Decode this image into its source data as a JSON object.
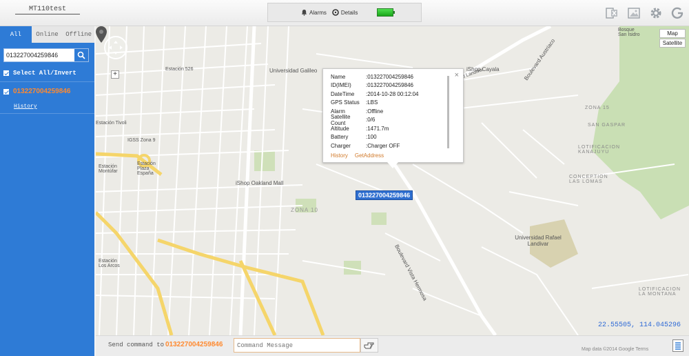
{
  "header": {
    "device_title": "MT110test",
    "alarms_label": "Alarms",
    "details_label": "Details",
    "icons": [
      "excel-icon",
      "image-icon",
      "gear-icon",
      "logout-icon"
    ]
  },
  "sidebar": {
    "tabs": [
      {
        "label": "All",
        "active": true
      },
      {
        "label": "Online",
        "active": false
      },
      {
        "label": "Offline",
        "active": false
      }
    ],
    "search_value": "013227004259846",
    "select_all_label": "Select All/Invert",
    "devices": [
      {
        "imei": "013227004259846",
        "history_label": "History"
      }
    ]
  },
  "map": {
    "map_button": "Map",
    "satellite_button": "Satellite",
    "marker_label": "013227004259846",
    "coordinates": "22.55505, 114.045296",
    "credit": "Map data ©2014 Google  Terms",
    "places": [
      {
        "name": "Universidad Galileo"
      },
      {
        "name": "iShop Cayala"
      },
      {
        "name": "iShop Oakland Mall"
      },
      {
        "name": "Estación Plaza España"
      },
      {
        "name": "Estación Montúfar"
      },
      {
        "name": "IGSS Zona 9"
      },
      {
        "name": "Estación 526"
      },
      {
        "name": "ZONA 10"
      },
      {
        "name": "ZONA 15"
      },
      {
        "name": "SAN GASPAR"
      },
      {
        "name": "LOTIFICACION KANAJUYU"
      },
      {
        "name": "CONCEPTION LAS LOMAS"
      },
      {
        "name": "Universidad Rafael Landivar"
      },
      {
        "name": "LOTIFICACION LA MONTANA"
      },
      {
        "name": "Boulevard Vista Hermosa"
      },
      {
        "name": "Boulevard Austriaco"
      },
      {
        "name": "Bosque San Isidro"
      },
      {
        "name": "Estación Los Arcos"
      },
      {
        "name": "Estación Tivoli"
      },
      {
        "name": "Boulevard Landivar"
      }
    ]
  },
  "info_window": {
    "rows": [
      {
        "key": "Name",
        "value": ":013227004259846"
      },
      {
        "key": "ID(IMEI)",
        "value": ":013227004259846"
      },
      {
        "key": "DateTime",
        "value": ":2014-10-28 00:12:04"
      },
      {
        "key": "GPS Status",
        "value": ":LBS"
      },
      {
        "key": "Alarm",
        "value": ":Offline"
      },
      {
        "key": "Satellite Count",
        "value": ":0/6"
      },
      {
        "key": "Altitude",
        "value": ":1471.7m"
      },
      {
        "key": "Battery",
        "value": ":100"
      },
      {
        "key": "Charger",
        "value": ":Charger OFF"
      }
    ],
    "history_link": "History",
    "getaddress_link": "GetAddress",
    "close": "×"
  },
  "command_bar": {
    "label": "Send command to",
    "imei": "013227004259846",
    "placeholder": "Command Message"
  },
  "colors": {
    "accent_blue": "#2e7bd6",
    "imei_orange": "#ff8a30",
    "link_orange": "#d17a2b",
    "coords_blue": "#2e6ad6"
  }
}
